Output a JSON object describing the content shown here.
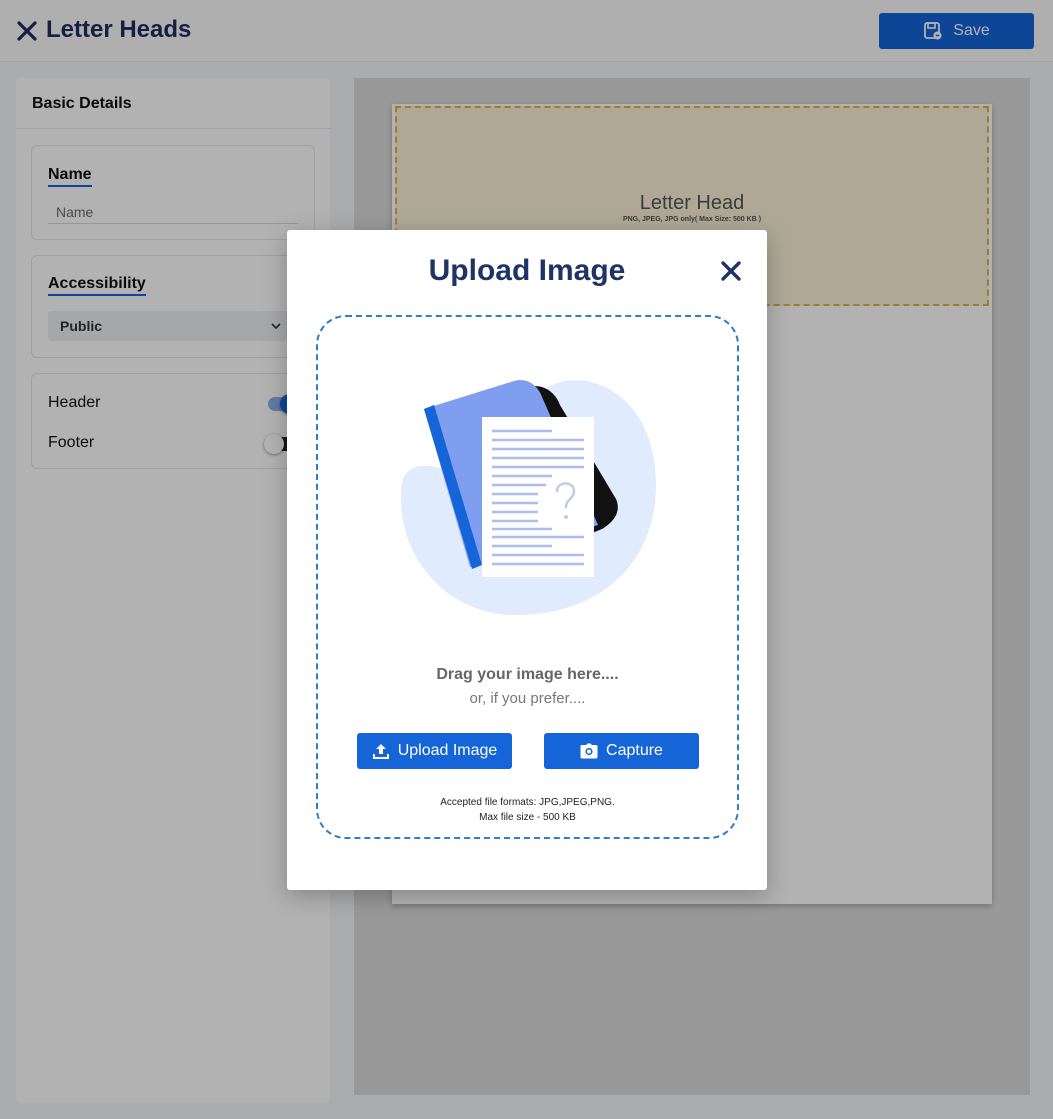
{
  "topbar": {
    "title": "Letter Heads",
    "save_label": "Save"
  },
  "left_panel": {
    "heading": "Basic Details",
    "name": {
      "label": "Name",
      "placeholder": "Name",
      "value": ""
    },
    "accessibility": {
      "label": "Accessibility",
      "selected": "Public"
    },
    "toggles": [
      {
        "label": "Header",
        "on": true
      },
      {
        "label": "Footer",
        "on": false
      }
    ]
  },
  "preview": {
    "letter_head_title": "Letter Head",
    "letter_head_hint": "PNG, JPEG, JPG only( Max Size: 500 KB )"
  },
  "modal": {
    "title": "Upload Image",
    "drag_text": "Drag your image here....",
    "or_text": "or, if you prefer....",
    "upload_label": "Upload Image",
    "capture_label": "Capture",
    "formats_line": "Accepted file formats: JPG,JPEG,PNG.",
    "size_line": "Max file size - 500 KB"
  },
  "colors": {
    "primary": "#1565d8",
    "title_navy": "#1f3466",
    "dashed_border": "#2f7fc8",
    "letterhead_border": "#e2b33d"
  },
  "icons": [
    "close-icon",
    "save-icon",
    "chevron-down-icon",
    "upload-icon",
    "camera-icon",
    "document-illustration"
  ]
}
